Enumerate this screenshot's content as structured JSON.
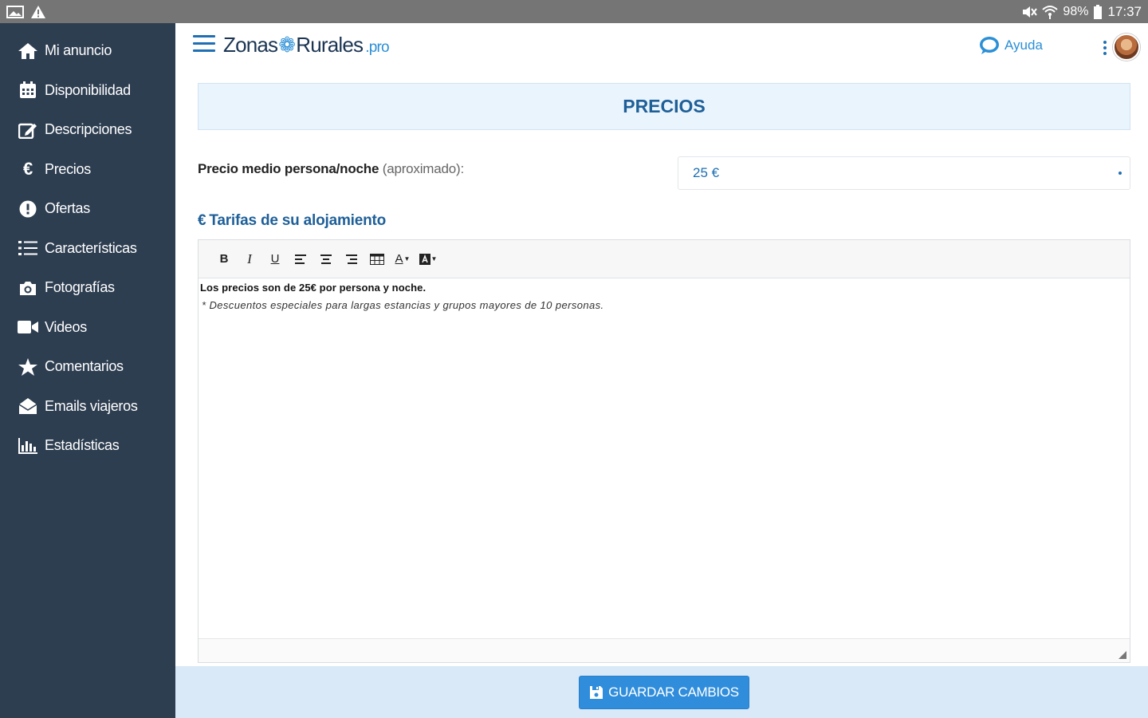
{
  "status_bar": {
    "battery": "98%",
    "time": "17:37"
  },
  "sidebar": {
    "items": [
      {
        "label": "Mi anuncio",
        "icon": "home-icon"
      },
      {
        "label": "Disponibilidad",
        "icon": "calendar-icon"
      },
      {
        "label": "Descripciones",
        "icon": "edit-icon"
      },
      {
        "label": "Precios",
        "icon": "euro-icon",
        "glyph": "€"
      },
      {
        "label": "Ofertas",
        "icon": "alert-circle-icon"
      },
      {
        "label": "Características",
        "icon": "list-icon"
      },
      {
        "label": "Fotografías",
        "icon": "camera-icon"
      },
      {
        "label": "Videos",
        "icon": "video-icon"
      },
      {
        "label": "Comentarios",
        "icon": "star-icon"
      },
      {
        "label": "Emails viajeros",
        "icon": "envelope-open-icon"
      },
      {
        "label": "Estadísticas",
        "icon": "bar-chart-icon"
      }
    ]
  },
  "header": {
    "logo_part1": "Zonas",
    "logo_part2": "Rurales",
    "logo_suffix": ".pro",
    "help_label": "Ayuda"
  },
  "main": {
    "section_title": "PRECIOS",
    "price_label": "Precio medio persona/noche",
    "price_label_note": "(aproximado):",
    "price_value": "25 €",
    "tarifas_title": "Tarifas de su alojamiento",
    "tarifas_icon_glyph": "€",
    "editor_toolbar": {
      "bold": "B",
      "italic": "I",
      "underline": "U",
      "text_color": "A"
    },
    "editor_lines": [
      "Los precios son de 25€ por persona y noche.",
      "* Descuentos especiales para largas estancias y grupos mayores de 10 personas."
    ]
  },
  "footer": {
    "save_label": "GUARDAR CAMBIOS"
  },
  "colors": {
    "sidebar_bg": "#2e3e51",
    "accent": "#2f8ddc",
    "title_blue": "#1e5f98",
    "bottom_bar": "#d9e9f8"
  }
}
